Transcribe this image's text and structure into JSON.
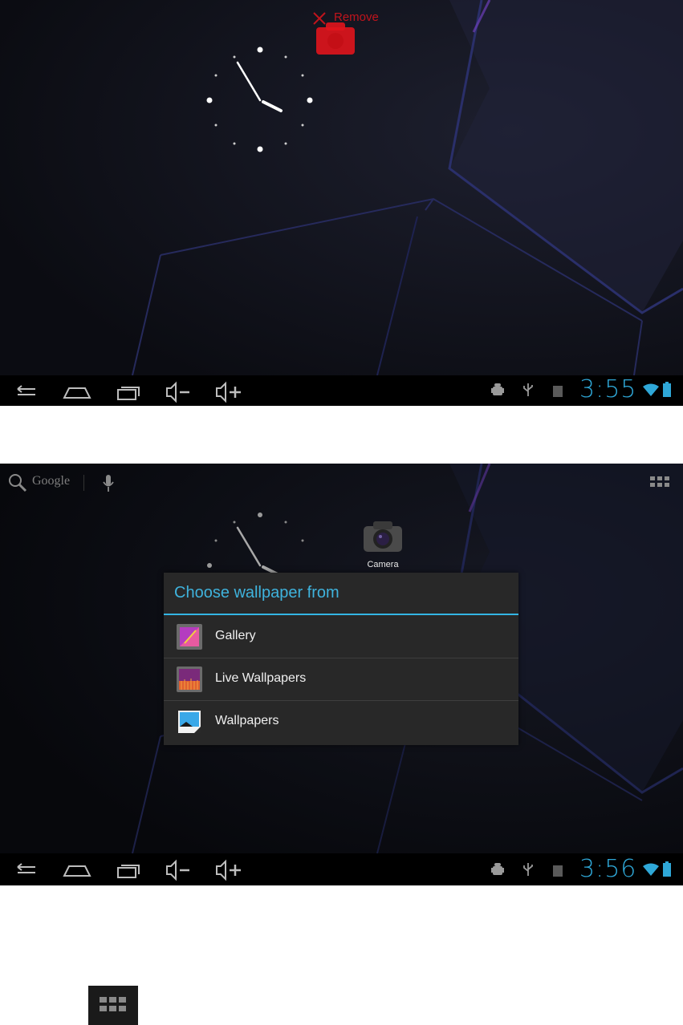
{
  "screen1": {
    "remove_label": "Remove",
    "statusbar": {
      "time": "3:55"
    },
    "navbar": {
      "buttons": [
        "back",
        "home",
        "recent-apps",
        "volume-down",
        "volume-up"
      ]
    }
  },
  "screen2": {
    "search": {
      "label": "Google"
    },
    "camera": {
      "label": "Camera"
    },
    "dialog": {
      "title": "Choose wallpaper from",
      "items": [
        {
          "label": "Gallery",
          "icon": "gallery-icon"
        },
        {
          "label": "Live Wallpapers",
          "icon": "live-wallpapers-icon"
        },
        {
          "label": "Wallpapers",
          "icon": "wallpapers-icon"
        }
      ]
    },
    "statusbar": {
      "time": "3:56"
    },
    "navbar": {
      "buttons": [
        "back",
        "home",
        "recent-apps",
        "volume-down",
        "volume-up"
      ]
    }
  },
  "colors": {
    "accent": "#33b5e5",
    "remove": "#c0141c",
    "clock_time": "#2fa8d8"
  }
}
